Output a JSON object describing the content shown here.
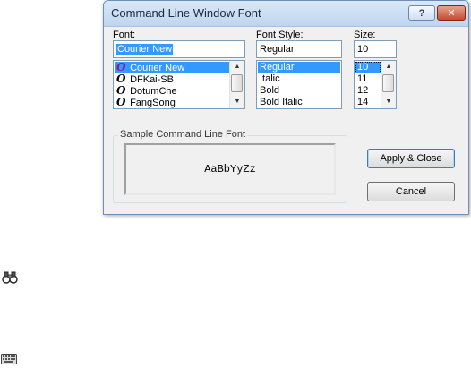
{
  "dialog": {
    "title": "Command Line Window Font",
    "help_label": "?",
    "close_label": "✕",
    "font": {
      "label": "Font:",
      "value": "Courier New",
      "items": [
        "Courier New",
        "DFKai-SB",
        "DotumChe",
        "FangSong"
      ],
      "selected_index": 0,
      "type_glyph": "O"
    },
    "style": {
      "label": "Font Style:",
      "value": "Regular",
      "items": [
        "Regular",
        "Italic",
        "Bold",
        "Bold Italic"
      ],
      "selected_index": 0
    },
    "size": {
      "label": "Size:",
      "value": "10",
      "items": [
        "10",
        "11",
        "12",
        "14"
      ],
      "selected_index": 0
    },
    "sample": {
      "group_label": "Sample Command Line Font",
      "text": "AaBbYyZz"
    },
    "buttons": {
      "apply_close": "Apply & Close",
      "cancel": "Cancel"
    }
  },
  "desktop_icons": [
    {
      "name": "binoculars-icon"
    },
    {
      "name": "keyboard-icon"
    }
  ]
}
